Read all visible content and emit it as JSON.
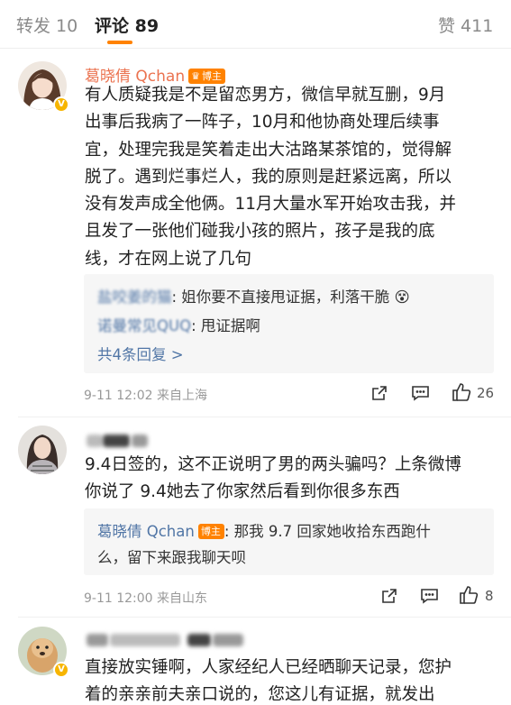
{
  "tabs": {
    "repost": "转发 10",
    "comments": "评论 89",
    "likes": "赞 411"
  },
  "comments": [
    {
      "author": "葛晓倩 Qchan",
      "badge": "博主",
      "lines": [
        "有人质疑我是不是留恋男方，微信早就互删，9月",
        "出事后我病了一阵子，10月和他协商处理后续事",
        "宜，处理完我是笑着走出大沽路某茶馆的，觉得解",
        "脱了。遇到烂事烂人，我的原则是赶紧远离，所以",
        "没有发声成全他俩。11月大量水军开始攻击我，并",
        "且发了一张他们碰我小孩的照片，孩子是我的底",
        "线，才在网上说了几句"
      ],
      "replies": [
        {
          "name": "盐咬姜的猫",
          "text": ": 姐你要不直接甩证据，利落干脆"
        },
        {
          "name": "诺曼常见QUQ",
          "text": ": 甩证据啊"
        }
      ],
      "more_replies": "共4条回复 >",
      "time_location": "9-11 12:02  来自上海",
      "like_count": "26"
    },
    {
      "lines": [
        "9.4日签的，这不正说明了男的两头骗吗？上条微博",
        "你说了 9.4她去了你家然后看到你很多东西"
      ],
      "replies": [
        {
          "name": "葛晓倩 Qchan",
          "badge": "博主",
          "text": ": 那我 9.7 回家她收拾东西跑什",
          "text2": "么，留下来跟我聊天呗"
        }
      ],
      "time_location": "9-11 12:00  来自山东",
      "like_count": "8"
    },
    {
      "lines": [
        "直接放实锤啊，人家经纪人已经晒聊天记录，您护",
        "着的亲亲前夫亲口说的，您这儿有证据，就发出"
      ]
    }
  ],
  "icon_color": "#333333",
  "accent_color": "#ff8200",
  "name_color": "#eb7350",
  "link_color": "#5176a6"
}
